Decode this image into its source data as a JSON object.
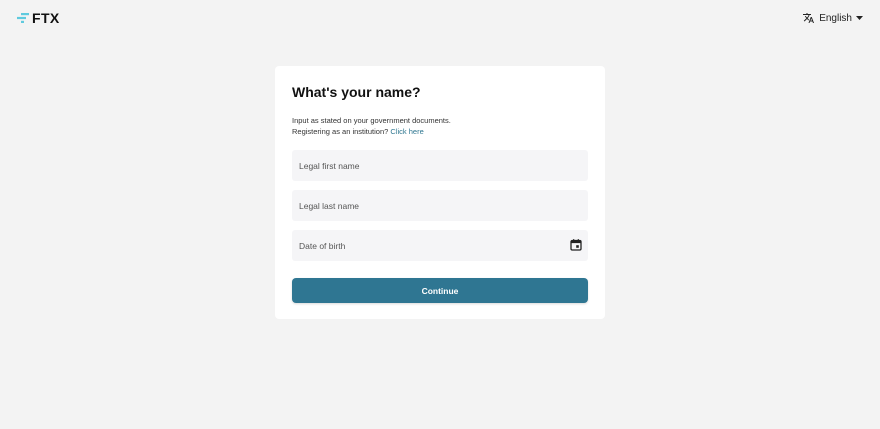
{
  "brand": {
    "name": "FTX",
    "accent_color": "#5fcade",
    "icon": "ftx-logo-icon"
  },
  "language": {
    "icon": "translate-icon",
    "label": "English",
    "chevron_icon": "caret-down-icon"
  },
  "form": {
    "title": "What's your name?",
    "subtitle_line1": "Input as stated on your government documents.",
    "subtitle_line2_prefix": "Registering as an institution?",
    "institution_link": "Click here",
    "link_color": "#2e7690",
    "first_name": {
      "value": "",
      "placeholder": "Legal first name"
    },
    "last_name": {
      "value": "",
      "placeholder": "Legal last name"
    },
    "dob": {
      "value": "",
      "placeholder": "Date of birth",
      "icon": "calendar-icon"
    },
    "continue_label": "Continue",
    "button_color": "#2f7692"
  }
}
